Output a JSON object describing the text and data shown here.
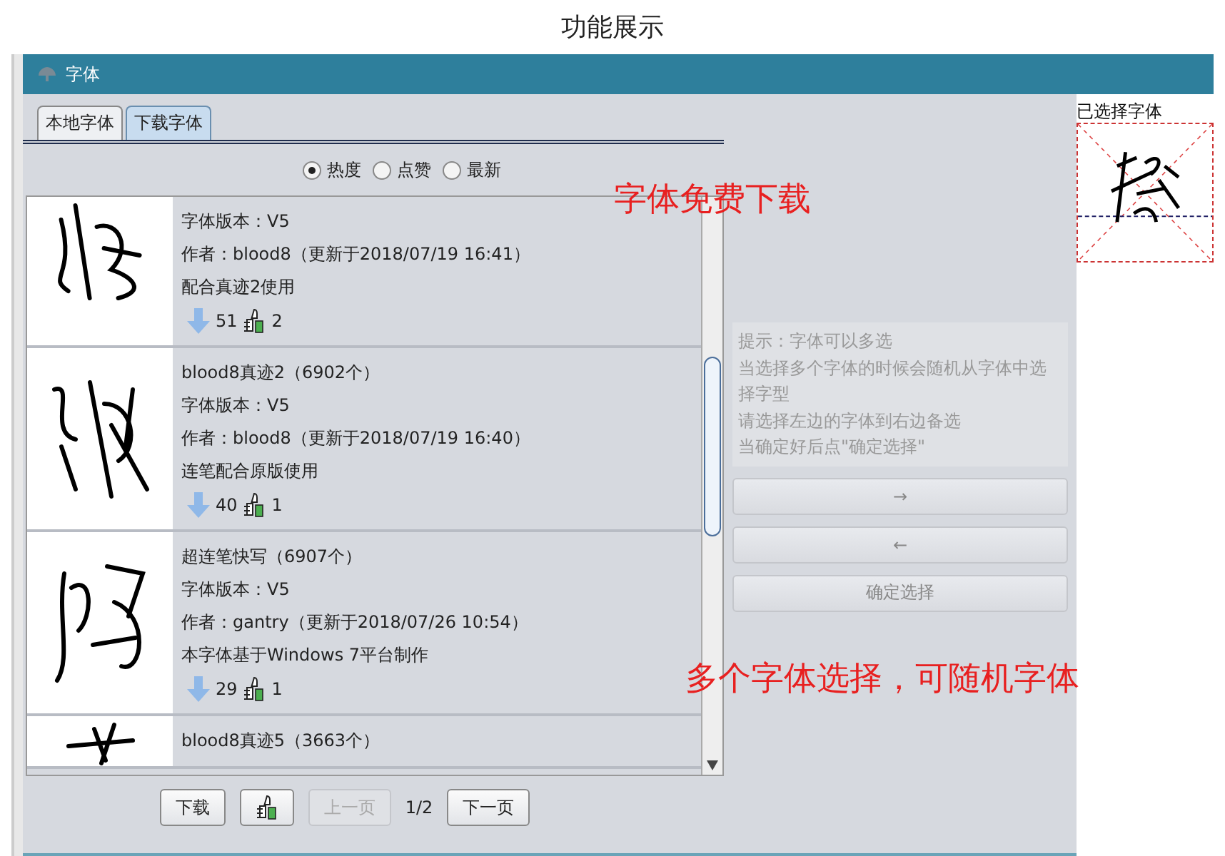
{
  "page_title": "功能展示",
  "window": {
    "title": "字体"
  },
  "tabs": [
    {
      "label": "本地字体",
      "selected": false
    },
    {
      "label": "下载字体",
      "selected": true
    }
  ],
  "sort_options": [
    {
      "label": "热度",
      "selected": true
    },
    {
      "label": "点赞",
      "selected": false
    },
    {
      "label": "最新",
      "selected": false
    }
  ],
  "fonts": [
    {
      "version": "字体版本：V5",
      "author": "作者：blood8（更新于2018/07/19 16:41）",
      "note": "配合真迹2使用",
      "downloads": "51",
      "likes": "2"
    },
    {
      "name": "blood8真迹2（6902个）",
      "version": "字体版本：V5",
      "author": "作者：blood8（更新于2018/07/19 16:40）",
      "note": "连笔配合原版使用",
      "downloads": "40",
      "likes": "1"
    },
    {
      "name": "超连笔快写（6907个）",
      "version": "字体版本：V5",
      "author": "作者：gantry（更新于2018/07/26 10:54）",
      "note": "本字体基于Windows 7平台制作",
      "downloads": "29",
      "likes": "1"
    },
    {
      "name": "blood8真迹5（3663个）"
    }
  ],
  "pager": {
    "download_label": "下载",
    "prev": {
      "label": "上一页",
      "disabled": true
    },
    "page": "1/2",
    "next": {
      "label": "下一页",
      "disabled": false
    }
  },
  "hint_lines": [
    "提示：字体可以多选",
    "当选择多个字体的时候会随机从字体中选择字型",
    "请选择左边的字体到右边备选",
    "当确定好后点\"确定选择\""
  ],
  "actions": [
    {
      "label": "→",
      "disabled": true
    },
    {
      "label": "←",
      "disabled": true
    },
    {
      "label": "确定选择",
      "disabled": true
    }
  ],
  "selected_panel": {
    "title": "已选择字体"
  },
  "annotations": [
    {
      "text": "字体免费下载"
    },
    {
      "text": "多个字体选择，可随机字体"
    }
  ]
}
